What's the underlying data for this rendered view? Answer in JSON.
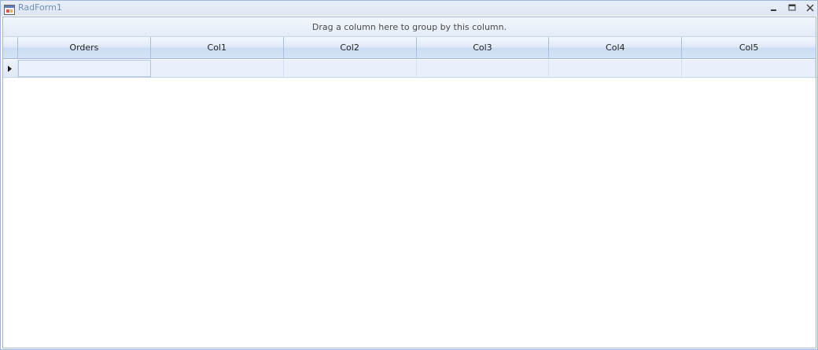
{
  "window": {
    "title": "RadForm1",
    "icons": {
      "app": "app-window-icon",
      "minimize": "minimize-icon",
      "maximize": "maximize-icon",
      "close": "close-icon"
    }
  },
  "grid": {
    "group_panel_text": "Drag a column here to group by this column.",
    "columns": [
      "Orders",
      "Col1",
      "Col2",
      "Col3",
      "Col4",
      "Col5"
    ],
    "rows": [
      [
        "",
        "",
        "",
        "",
        "",
        ""
      ]
    ],
    "current_row_icon": "row-pointer-icon"
  },
  "colors": {
    "accent": "#9fb6d8",
    "title_text": "#6f8fb5"
  }
}
